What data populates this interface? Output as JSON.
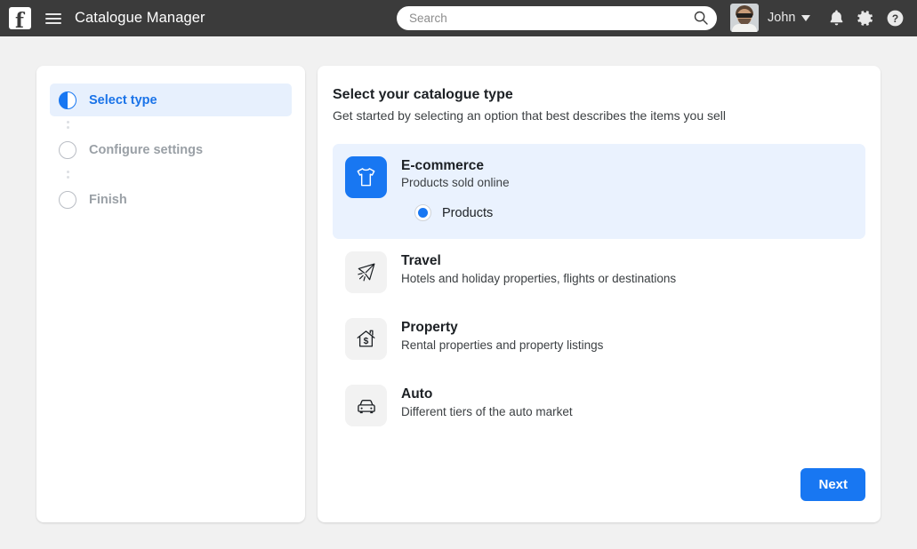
{
  "topbar": {
    "logo": "facebook-logo",
    "logo_letter": "f",
    "menu_icon": "hamburger-menu-icon",
    "title": "Catalogue Manager",
    "search": {
      "value": "",
      "placeholder": "Search",
      "icon": "search-icon"
    },
    "user": {
      "name": "John",
      "avatar": "user-avatar",
      "caret": "chevron-down-icon"
    },
    "icons": [
      {
        "name": "notifications-bell-icon"
      },
      {
        "name": "settings-gear-icon"
      },
      {
        "name": "help-question-icon"
      }
    ]
  },
  "sidebar": {
    "steps": [
      {
        "label": "Select type",
        "state": "active"
      },
      {
        "label": "Configure settings",
        "state": "pending"
      },
      {
        "label": "Finish",
        "state": "pending"
      }
    ]
  },
  "main": {
    "title": "Select your catalogue type",
    "subtitle": "Get started by selecting an option that best describes the items you sell",
    "options": [
      {
        "title": "E-commerce",
        "description": "Products sold online",
        "icon": "tshirt-icon",
        "selected": true,
        "sub_choice": {
          "label": "Products",
          "checked": true
        }
      },
      {
        "title": "Travel",
        "description": "Hotels and holiday properties, flights or destinations",
        "icon": "airplane-icon",
        "selected": false
      },
      {
        "title": "Property",
        "description": "Rental properties and property listings",
        "icon": "house-dollar-icon",
        "selected": false
      },
      {
        "title": "Auto",
        "description": "Different tiers of the auto market",
        "icon": "car-icon",
        "selected": false
      }
    ],
    "next_label": "Next"
  },
  "colors": {
    "accent": "#1877f2",
    "topbar": "#3b3b3b",
    "page_bg": "#f1f1f1",
    "selected_bg": "#eaf2fe",
    "step_active_bg": "#e7f0fd"
  }
}
